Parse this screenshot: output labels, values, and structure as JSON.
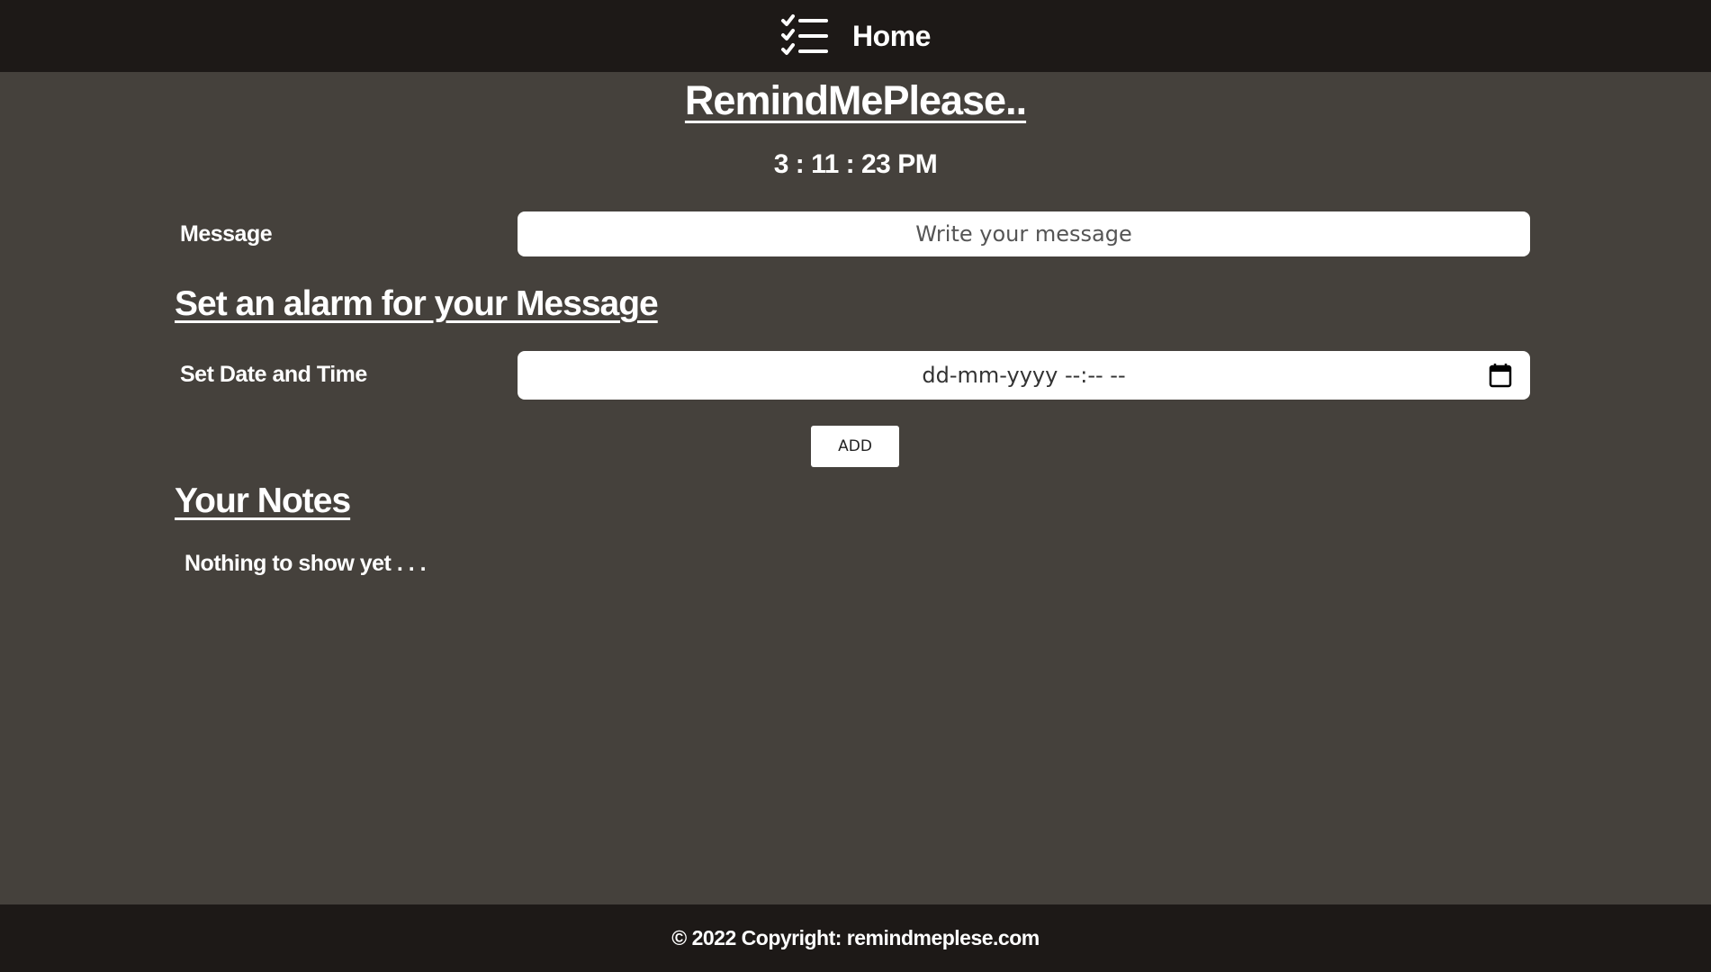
{
  "navbar": {
    "icon": "checklist-icon",
    "title": "Home"
  },
  "app": {
    "title": "RemindMePlease..",
    "clock": "3 : 11 : 23 PM"
  },
  "message_form": {
    "label": "Message",
    "placeholder": "Write your message",
    "value": ""
  },
  "alarm": {
    "heading": "Set an alarm for your Message",
    "label": "Set Date and Time",
    "placeholder": "dd-mm-yyyy --:-- --",
    "icon": "calendar-icon"
  },
  "add_button": {
    "label": "ADD"
  },
  "notes": {
    "heading": "Your Notes",
    "empty_text": "Nothing to show yet . . ."
  },
  "footer": {
    "text": "© 2022 Copyright: remindmeplese.com"
  },
  "colors": {
    "navbar_bg": "#1d1917",
    "page_bg": "#45413c",
    "text": "#ffffff",
    "input_bg": "#ffffff"
  }
}
